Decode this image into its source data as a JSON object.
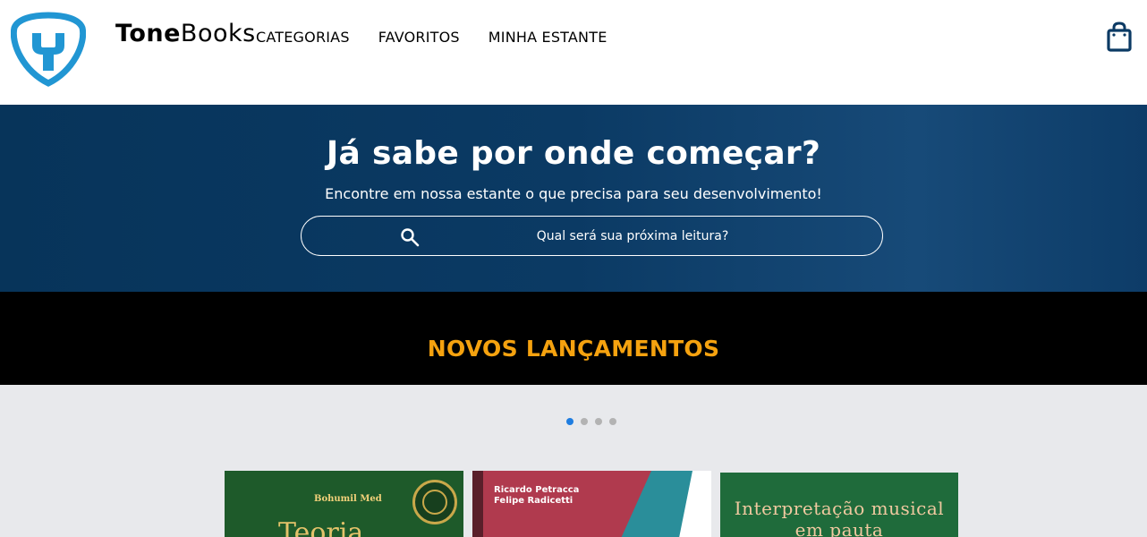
{
  "header": {
    "brand_bold": "Tone",
    "brand_light": "Books",
    "nav": [
      {
        "label": "CATEGORIAS"
      },
      {
        "label": "FAVORITOS"
      },
      {
        "label": "MINHA ESTANTE"
      }
    ],
    "logo_icon": "tonebooks-shield-logo",
    "cart_icon": "shopping-bag-icon"
  },
  "hero": {
    "title": "Já sabe por onde começar?",
    "subtitle": "Encontre em nossa estante o que precisa para seu desenvolvimento!",
    "search": {
      "placeholder": "Qual será sua próxima leitura?",
      "value": "",
      "icon": "search-icon"
    }
  },
  "releases": {
    "title": "NOVOS LANÇAMENTOS",
    "dots": [
      true,
      false,
      false,
      false
    ],
    "books": [
      {
        "author": "Bohumil Med",
        "title": "Teoria"
      },
      {
        "names": [
          "Ricardo Petracca",
          "Felipe Radicetti"
        ]
      },
      {
        "title": "Interpretação musical em pauta"
      }
    ]
  },
  "colors": {
    "hero_bg": "#0b3a64",
    "accent_orange": "#f5a20f",
    "logo_blue": "#2196d3",
    "active_dot": "#1f7de0",
    "band_bg": "#000000"
  }
}
